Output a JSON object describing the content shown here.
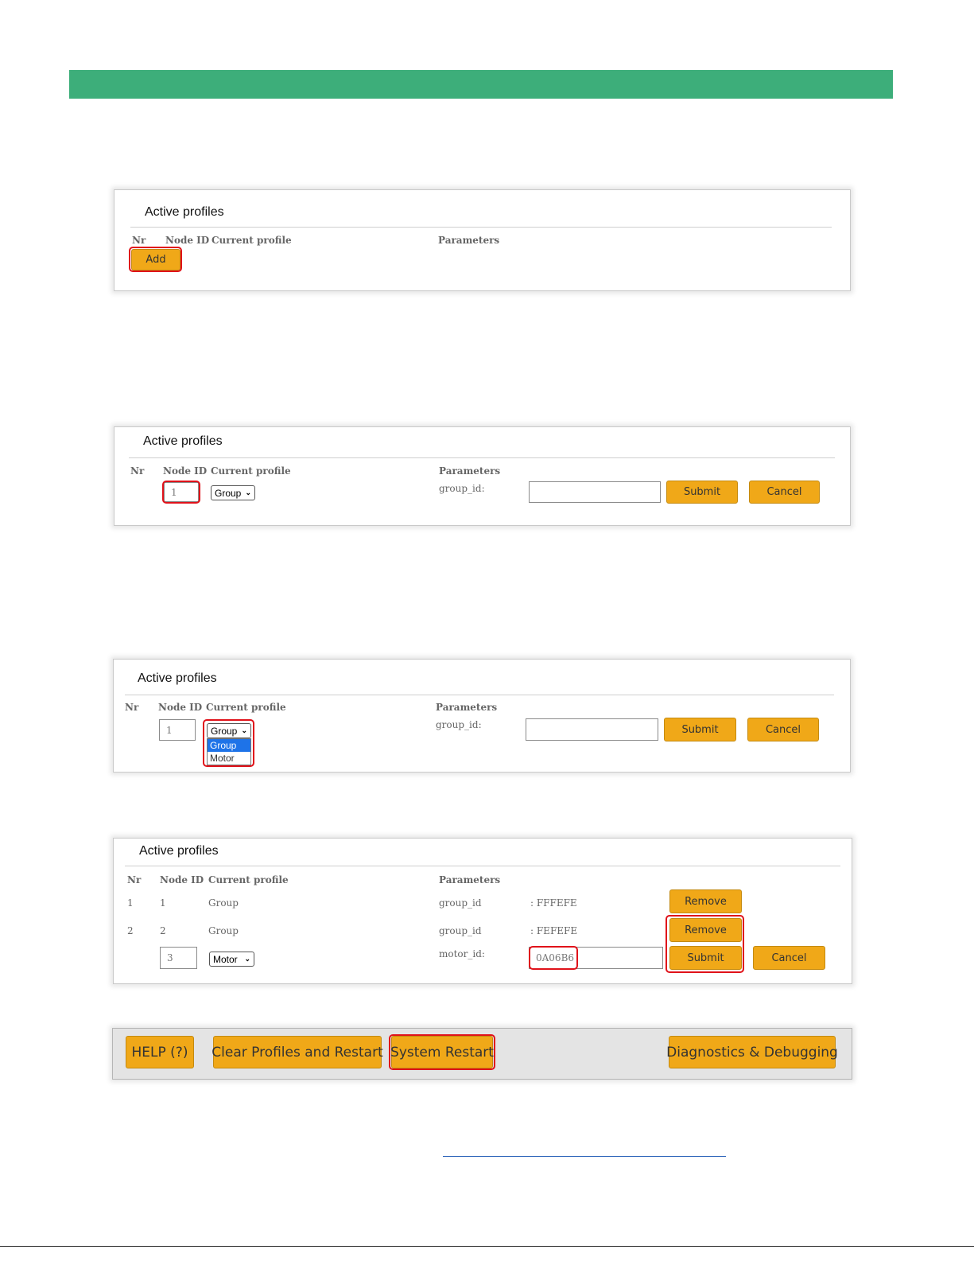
{
  "panel1": {
    "title": "Active profiles",
    "headers": {
      "nr": "Nr",
      "node_id": "Node ID",
      "current_profile": "Current profile",
      "parameters": "Parameters"
    },
    "add_label": "Add"
  },
  "panel2": {
    "title": "Active profiles",
    "headers": {
      "nr": "Nr",
      "node_id": "Node ID",
      "current_profile": "Current profile",
      "parameters": "Parameters"
    },
    "node_id_value": "1",
    "profile_select": "Group",
    "param_label": "group_id:",
    "param_value": "",
    "submit_label": "Submit",
    "cancel_label": "Cancel"
  },
  "panel3": {
    "title": "Active profiles",
    "headers": {
      "nr": "Nr",
      "node_id": "Node ID",
      "current_profile": "Current profile",
      "parameters": "Parameters"
    },
    "node_id_value": "1",
    "profile_select": "Group",
    "options": [
      "Group",
      "Motor"
    ],
    "param_label": "group_id:",
    "param_value": "",
    "submit_label": "Submit",
    "cancel_label": "Cancel"
  },
  "panel4": {
    "title": "Active profiles",
    "headers": {
      "nr": "Nr",
      "node_id": "Node ID",
      "current_profile": "Current profile",
      "parameters": "Parameters"
    },
    "rows": [
      {
        "nr": "1",
        "node_id": "1",
        "profile": "Group",
        "param": "group_id",
        "value": ": FFFEFE",
        "remove_label": "Remove"
      },
      {
        "nr": "2",
        "node_id": "2",
        "profile": "Group",
        "param": "group_id",
        "value": ": FEFEFE",
        "remove_label": "Remove"
      }
    ],
    "new_row": {
      "node_id_value": "3",
      "profile_select": "Motor",
      "param_label": "motor_id:",
      "param_value": "0A06B6",
      "submit_label": "Submit",
      "cancel_label": "Cancel"
    }
  },
  "footer": {
    "help_label": "HELP (?)",
    "clear_label": "Clear Profiles and Restart",
    "restart_label": "System Restart",
    "diag_label": "Diagnostics & Debugging"
  },
  "colors": {
    "header_bar": "#3dae7a",
    "button": "#f0a818",
    "highlight": "#e0121a",
    "link": "#2a62b8"
  }
}
